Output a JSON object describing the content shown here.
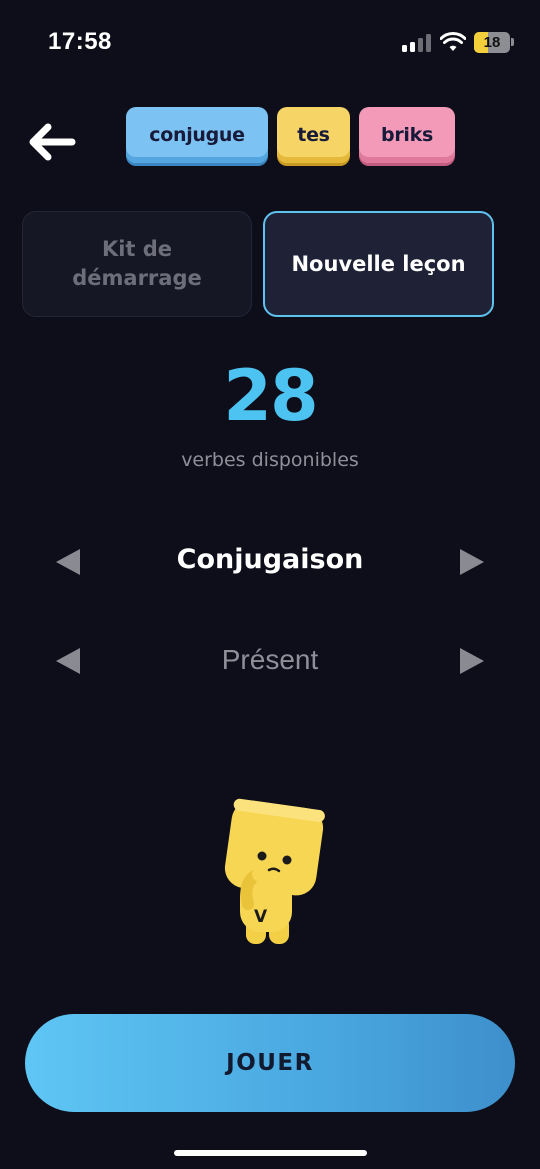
{
  "status_bar": {
    "time": "17:58",
    "battery_level": "18",
    "icons": [
      "signal-icon",
      "wifi-icon",
      "battery-icon"
    ]
  },
  "header": {
    "back_icon": "arrow-left-icon",
    "title_words": [
      "conjugue",
      "tes",
      "briks"
    ],
    "title_colors": [
      "#7cc3f4",
      "#f6d566",
      "#f29ab8"
    ]
  },
  "tabs": [
    {
      "label": "Kit de démarrage",
      "selected": false
    },
    {
      "label": "Nouvelle leçon",
      "selected": true
    }
  ],
  "counter": {
    "value": "28",
    "label": "verbes disponibles"
  },
  "selectors": {
    "mode": {
      "value": "Conjugaison"
    },
    "tense": {
      "value": "Présent"
    }
  },
  "mascot": {
    "icon": "yellow-cube-mascot",
    "badge_letter": "V"
  },
  "play_button": {
    "label": "JOUER"
  },
  "colors": {
    "background": "#0d0e1a",
    "accent": "#4cc3f1",
    "tab_selected_border": "#5ec3ef"
  }
}
